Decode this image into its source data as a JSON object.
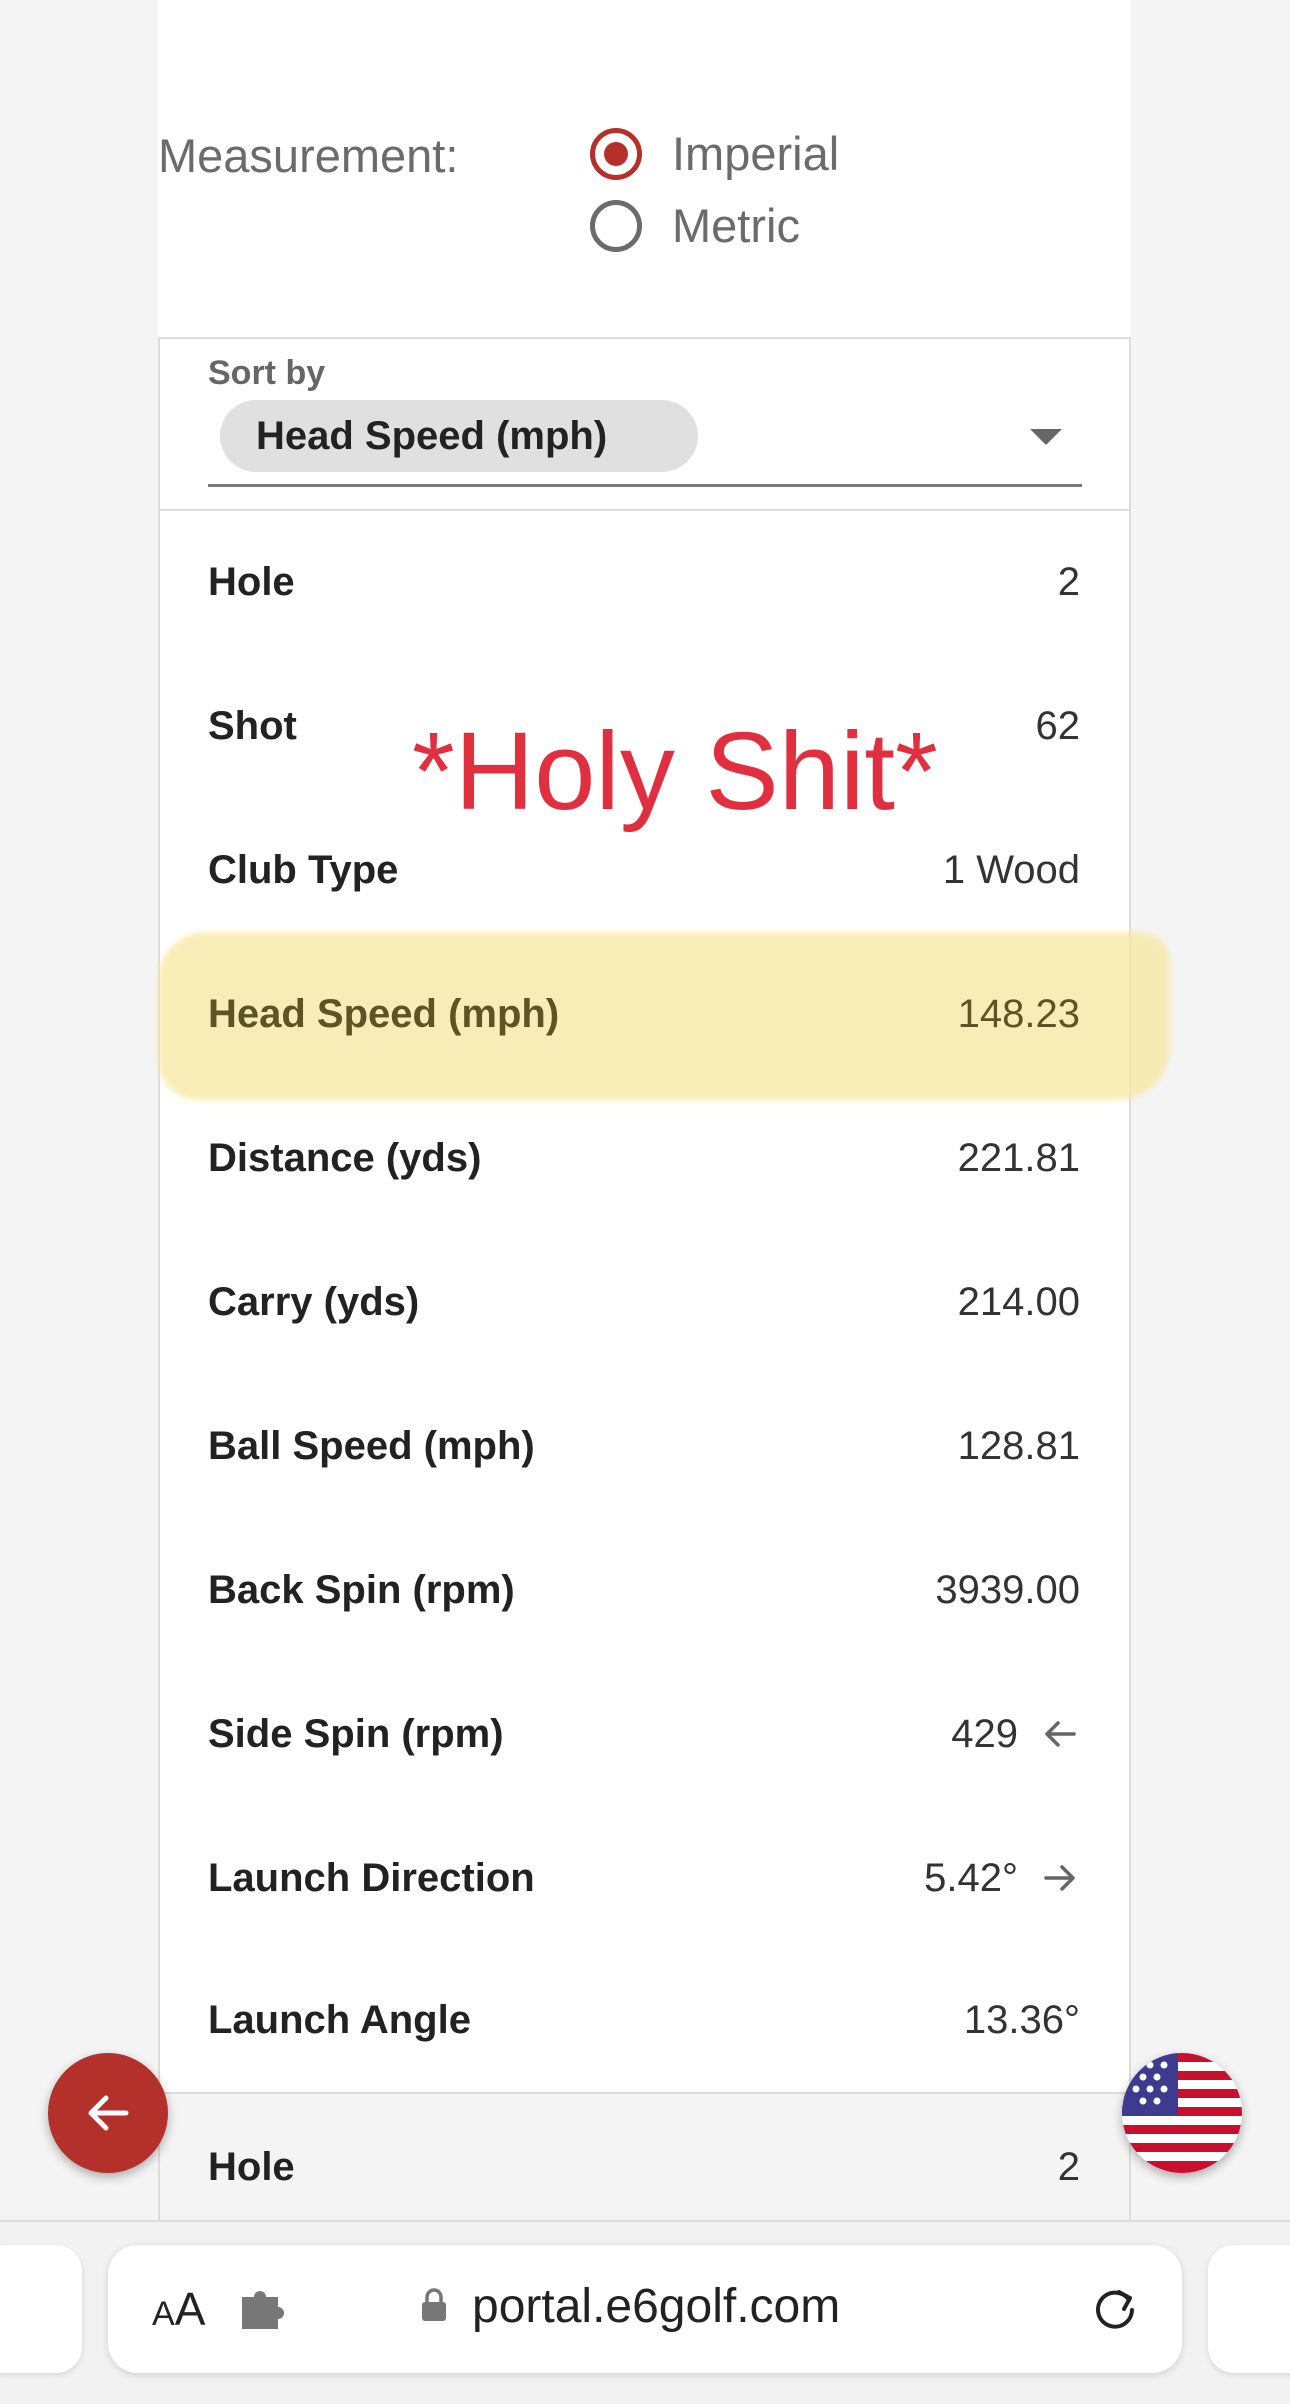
{
  "measurement": {
    "label": "Measurement:",
    "options": [
      {
        "label": "Imperial",
        "selected": true
      },
      {
        "label": "Metric",
        "selected": false
      }
    ]
  },
  "sort": {
    "label": "Sort by",
    "selected": "Head Speed (mph)"
  },
  "shot_rows": [
    {
      "label": "Hole",
      "value": "2"
    },
    {
      "label": "Shot",
      "value": "62"
    },
    {
      "label": "Club Type",
      "value": "1 Wood"
    },
    {
      "label": "Head Speed (mph)",
      "value": "148.23"
    },
    {
      "label": "Distance (yds)",
      "value": "221.81"
    },
    {
      "label": "Carry (yds)",
      "value": "214.00"
    },
    {
      "label": "Ball Speed (mph)",
      "value": "128.81"
    },
    {
      "label": "Back Spin (rpm)",
      "value": "3939.00"
    },
    {
      "label": "Side Spin (rpm)",
      "value": "429",
      "direction": "left"
    },
    {
      "label": "Launch Direction",
      "value": "5.42°",
      "direction": "right"
    },
    {
      "label": "Launch Angle",
      "value": "13.36°"
    }
  ],
  "next_row": {
    "label": "Hole",
    "value": "2"
  },
  "annotation": "*Holy Shit*",
  "highlight_color": "#f8e9a3",
  "accent_color": "#b3302b",
  "icons": {
    "back": "arrow-left-icon",
    "flag": "us-flag-icon",
    "extension": "puzzle-icon",
    "lock": "lock-icon",
    "reload": "reload-icon",
    "side_spin_arrow": "arrow-left-icon",
    "launch_dir_arrow": "arrow-right-icon"
  },
  "browser": {
    "text_size_big": "A",
    "text_size_small": "A",
    "url": "portal.e6golf.com"
  }
}
